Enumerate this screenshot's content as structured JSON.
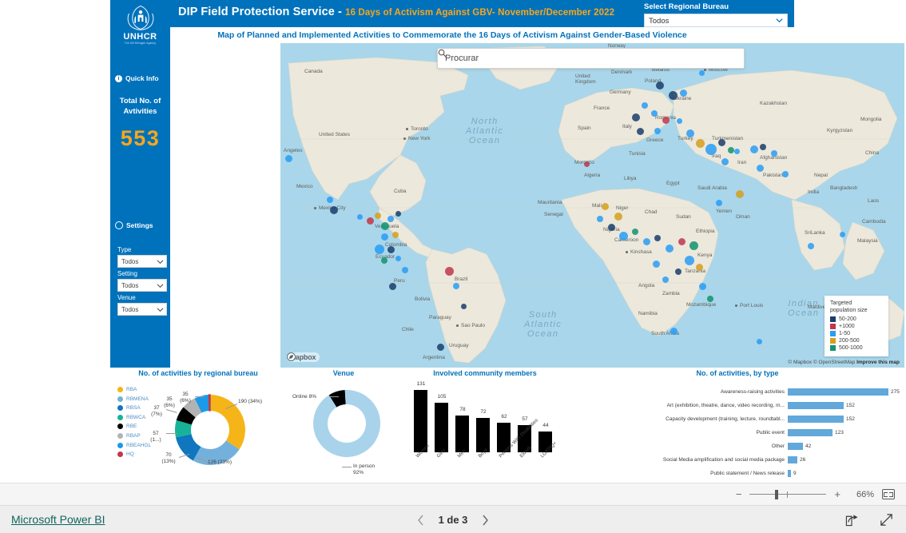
{
  "header": {
    "title_main": "DIP Field Protection Service - ",
    "title_sub": "16 Days of Activism Against GBV- November/December 2022",
    "bureau_label": "Select Regional Bureau",
    "bureau_value": "Todos",
    "subtitle": "Map of Planned and Implemented Activities to Commemorate the 16 Days of Activism Against Gender-Based Violence"
  },
  "brand": {
    "org_name": "UNHCR",
    "org_tagline": "The UN Refugee Agency",
    "accent_blue": "#0072bc",
    "accent_yellow": "#faa61a"
  },
  "rail": {
    "quick_info": "Quick Info",
    "total_label_line1": "Total No. of",
    "total_label_line2": "Avtivities",
    "total_value": "553",
    "settings": "Settings",
    "filters": [
      {
        "label": "Type",
        "value": "Todos"
      },
      {
        "label": "Setting",
        "value": "Todos"
      },
      {
        "label": "Venue",
        "value": "Todos"
      }
    ]
  },
  "map": {
    "search_placeholder": "Procurar",
    "legend_title_line1": "Targeted",
    "legend_title_line2": "population size",
    "legend_items": [
      {
        "label": "50-200",
        "color": "#1b3f6b"
      },
      {
        "label": "+1000",
        "color": "#c0394b"
      },
      {
        "label": "1-50",
        "color": "#2a9df4"
      },
      {
        "label": "200-500",
        "color": "#d5a020"
      },
      {
        "label": "500-1000",
        "color": "#119470"
      }
    ],
    "provider": "mapbox",
    "attribution": "© Mapbox © OpenStreetMap",
    "attribution_link": "Improve this map",
    "ocean_labels": [
      "North\nAtlantic\nOcean",
      "South\nAtlantic\nOcean",
      "Indian\nOcean"
    ],
    "place_labels": [
      "Canada",
      "United States",
      "Mexico",
      "Cuba",
      "Mexico City",
      "Toronto",
      "New York",
      "Angeles",
      "Venezuela",
      "Colombia",
      "Ecuador",
      "Peru",
      "Bolivia",
      "Brazil",
      "Paraguay",
      "Sao Paulo",
      "Chile",
      "Uruguay",
      "Argentina",
      "Norway",
      "Denmark",
      "United Kingdom",
      "France",
      "Spain",
      "Italy",
      "Germany",
      "Poland",
      "Belarus",
      "Ukraine",
      "Moscow",
      "Romania",
      "Greece",
      "Turkey",
      "Morocco",
      "Algeria",
      "Libya",
      "Egypt",
      "Tunisia",
      "Mauritania",
      "Mali",
      "Niger",
      "Chad",
      "Sudan",
      "Nigeria",
      "Cameroon",
      "Senegal",
      "Ethiopia",
      "Kenya",
      "Kinshasa",
      "Tanzania",
      "Angola",
      "Zambia",
      "Mozambique",
      "Namibia",
      "South Africa",
      "Port Louis",
      "Maldives",
      "Saudi Arabia",
      "Yemen",
      "Oman",
      "Iran",
      "Iraq",
      "Afghanistan",
      "Pakistan",
      "India",
      "Nepal",
      "Bangladesh",
      "Sri Lanka",
      "Kazakhstan",
      "Turkmenistan",
      "Kyrgyzstan",
      "Mongolia",
      "China",
      "Laos",
      "Cambodia",
      "Malaysia"
    ]
  },
  "chart_data": [
    {
      "type": "pie",
      "title": "No. of activities by regional bureau",
      "legend_position": "left",
      "categories": [
        "RBA",
        "RBMENA",
        "RBSA",
        "RBWCA",
        "RBE",
        "RBAP",
        "RBEAHGL",
        "HQ"
      ],
      "values": [
        190,
        126,
        70,
        57,
        37,
        35,
        35,
        3
      ],
      "percents": [
        "34%",
        "23%",
        "13%",
        "1...",
        "7%",
        "6%",
        "6%",
        ""
      ],
      "labels": [
        "190 (34%)",
        "126 (23%)",
        "70 (13%)",
        "57 (1...)",
        "37 (7%)",
        "35 (6%)",
        "35 (6%)",
        ""
      ],
      "colors": [
        "#f5b518",
        "#74b0dc",
        "#0f76bf",
        "#16b398",
        "#000000",
        "#b3b3b3",
        "#1b9ae8",
        "#c0394b"
      ]
    },
    {
      "type": "pie",
      "title": "Venue",
      "categories": [
        "In person",
        "Online"
      ],
      "values": [
        92,
        8
      ],
      "labels": [
        "In person 92%",
        "Online 8%"
      ],
      "colors": [
        "#a9d3ea",
        "#000000"
      ]
    },
    {
      "type": "bar",
      "title": "Involved community members",
      "categories": [
        "Women",
        "Girls",
        "Men",
        "Boys",
        "Persons With Disabilities",
        "Elderly",
        "LGBTIQ+"
      ],
      "values": [
        131,
        105,
        78,
        72,
        62,
        57,
        44
      ],
      "ylim": [
        0,
        131
      ],
      "color": "#000000"
    },
    {
      "type": "bar",
      "orientation": "horizontal",
      "title": "No. of activities, by type",
      "categories": [
        "Awareness-raising activities",
        "Art (exhibition, theatre, dance, video recording, m...",
        "Capacity development (training, lecture, roundtabl...",
        "Public event",
        "Other",
        "Social Media amplification and social media package",
        "Public statement / News release"
      ],
      "values": [
        275,
        152,
        152,
        123,
        42,
        26,
        9
      ],
      "xlim": [
        0,
        275
      ],
      "color": "#62a8da"
    }
  ],
  "zoombar": {
    "minus": "−",
    "plus": "+",
    "percent": "66%",
    "fit_icon": "fit-to-page-icon"
  },
  "statusbar": {
    "powerbi_link": "Microsoft Power BI",
    "prev_icon": "chevron-left-icon",
    "next_icon": "chevron-right-icon",
    "page_text": "1 de 3",
    "share_icon": "share-icon",
    "fullscreen_icon": "fullscreen-icon"
  }
}
